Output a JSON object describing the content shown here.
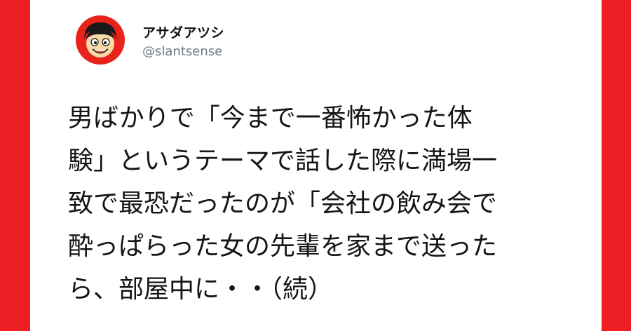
{
  "colors": {
    "background": "#ee1f24",
    "card": "#ffffff",
    "text": "#151515",
    "handle": "#6e7a84"
  },
  "profile": {
    "display_name": "アサダアツシ",
    "handle": "@slantsense",
    "avatar_icon": "cartoon-face-avatar-icon"
  },
  "tweet": {
    "lines": [
      "男ばかりで「今まで一番怖かった体",
      "験」というテーマで話した際に満場一",
      "致で最恐だったのが「会社の飲み会で",
      "酔っぱらった女の先輩を家まで送った",
      "ら、部屋中に・・（続）"
    ]
  }
}
